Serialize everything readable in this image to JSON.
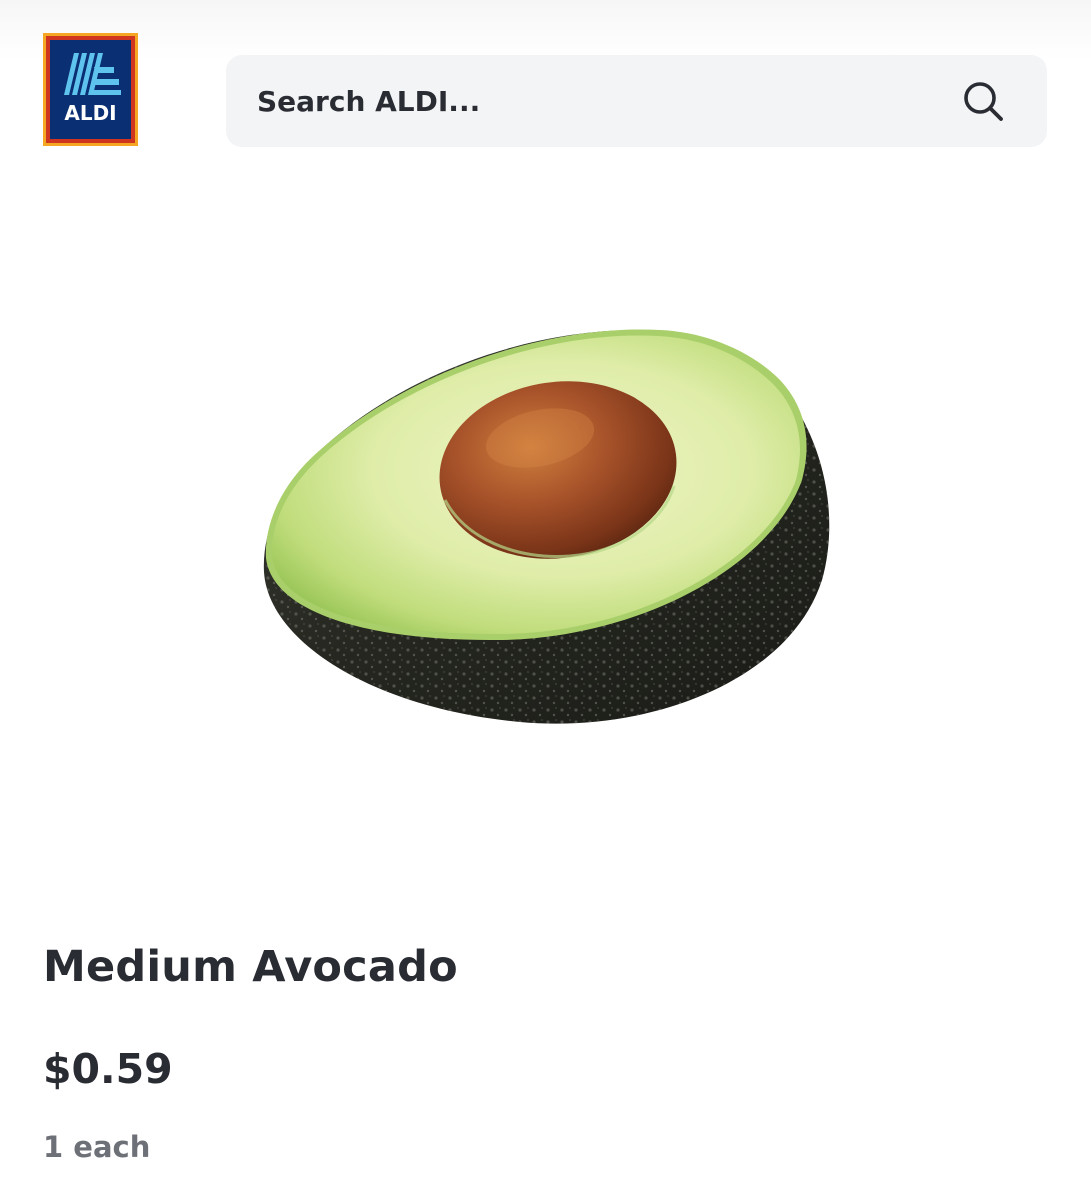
{
  "header": {
    "logo": {
      "text": "ALDI",
      "colors": {
        "frame_outer": "#f5a623",
        "frame_inner": "#d0351f",
        "background": "#0a2f73",
        "stripes": "#5ec4ee",
        "text": "#ffffff"
      }
    },
    "search": {
      "placeholder": "Search ALDI...",
      "icon": "search-icon"
    }
  },
  "product": {
    "image_icon": "avocado-half-image",
    "title": "Medium Avocado",
    "price": "$0.59",
    "unit": "1 each"
  },
  "colors": {
    "text_primary": "#2a2c33",
    "text_secondary": "#6e7078",
    "search_background": "#f3f4f6"
  }
}
